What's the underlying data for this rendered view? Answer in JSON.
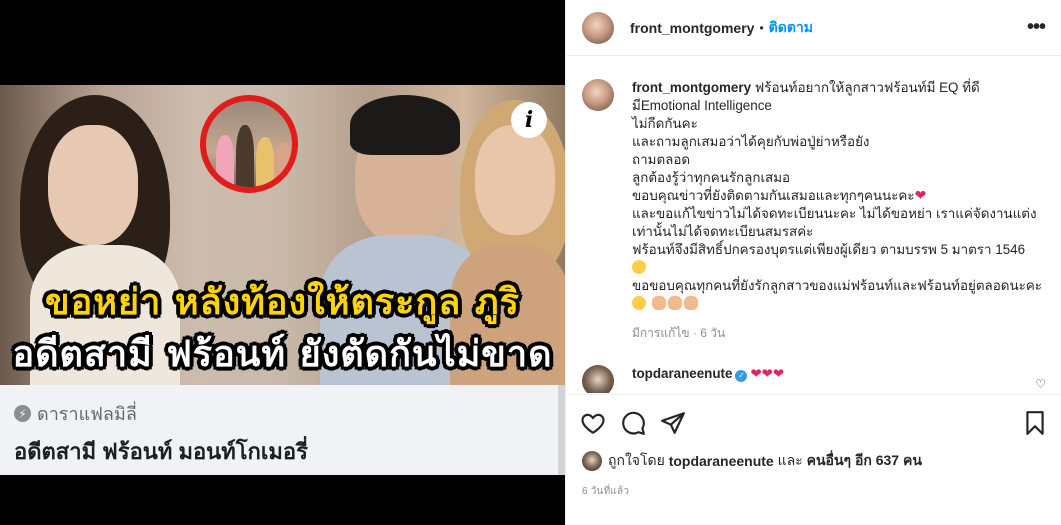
{
  "media": {
    "info_badge": "i",
    "headline_line1": "ขอหย่า หลังท้องให้ตระกูล ภูริ",
    "headline_line2": "อดีตสามี ฟร้อนท์ ยังตัดกันไม่ขาด",
    "link_card": {
      "source_icon": "bolt-icon",
      "source": "ดาราแฟลมิลี่",
      "title": "อดีตสามี ฟร้อนท์ มอนท์โกเมอรี่"
    }
  },
  "header": {
    "username": "front_montgomery",
    "dot": "•",
    "follow_label": "ติดตาม",
    "more_icon": "more-options-icon"
  },
  "caption": {
    "username": "front_montgomery",
    "lines": [
      "ฟร้อนท์อยากให้ลูกสาวฟร้อนท์มี EQ ที่ดี",
      "มีEmotional Intelligence",
      "ไม่กีดกันคะ",
      "และถามลูกเสมอว่าได้คุยกับพ่อปู่ย่าหรือยัง",
      "ถามตลอด",
      "ลูกต้องรู้ว่าทุกคนรักลูกเสมอ",
      "ขอบคุณข่าวที่ยังติดตามกันเสมอและทุกๆคนนะคะ",
      "และขอแก้ไขข่าวไม่ได้จดทะเบียนนะคะ ไม่ได้ขอหย่า เราแค่จัดงานแต่ง",
      "เท่านั้นไม่ได้จดทะเบียนสมรสค่ะ",
      "ฟร้อนท์จึงมีสิทธิ์ปกครองบุตรแต่เพียงผู้เดียว ตามบรรพ 5 มาตรา 1546",
      "",
      "ขอขอบคุณทุกคนที่ยังรักลูกสาวของแม่ฟร้อนท์และฟร้อนท์อยู่ตลอดนะคะ",
      ""
    ],
    "meta": "มีการแก้ไข · 6 วัน"
  },
  "comment": {
    "username": "topdaraneenute",
    "verified": "✓",
    "text": "❤❤❤",
    "like_icon": "♡"
  },
  "actions": {
    "like_icon": "heart-icon",
    "comment_icon": "comment-icon",
    "share_icon": "share-icon",
    "save_icon": "bookmark-icon"
  },
  "likes": {
    "prefix": "ถูกใจโดย",
    "user": "topdaraneenute",
    "and": "และ",
    "others": "คนอื่นๆ อีก 637 คน"
  },
  "time_ago": "6 วันที่แล้ว",
  "colors": {
    "accent": "#0095f6",
    "headline_yellow": "#ffd400",
    "inset_ring": "#e21b1b"
  }
}
